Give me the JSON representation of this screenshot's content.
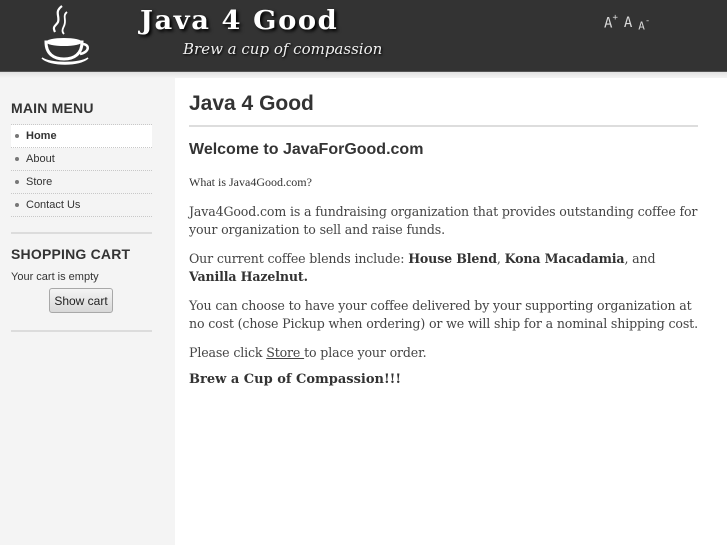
{
  "header": {
    "brand_title": "Java 4 Good",
    "tagline": "Brew a cup of compassion",
    "logo_icon": "coffee-cup-icon",
    "font_tools": {
      "increase_label": "A",
      "increase_sup": "+",
      "normal_label": "A",
      "decrease_label": "A",
      "decrease_sup": "-"
    }
  },
  "sidebar": {
    "main_menu": {
      "title": "MAIN MENU",
      "items": [
        {
          "label": "Home",
          "active": true
        },
        {
          "label": "About",
          "active": false
        },
        {
          "label": "Store",
          "active": false
        },
        {
          "label": "Contact Us",
          "active": false
        }
      ]
    },
    "shopping_cart": {
      "title": "SHOPPING CART",
      "status": "Your cart is empty",
      "button_label": "Show cart"
    }
  },
  "content": {
    "page_title": "Java 4 Good",
    "welcome": "Welcome to JavaForGood.com",
    "question": "What is Java4Good.com?",
    "intro": "Java4Good.com is a fundraising organization that provides outstanding coffee for your organization to sell and raise funds.",
    "blends": {
      "prefix": "Our current coffee blends include: ",
      "blend_1": "House Blend",
      "sep_1": ", ",
      "blend_2": "Kona Macadamia",
      "sep_2": ", and ",
      "blend_3": "Vanilla Hazelnut."
    },
    "delivery": "You can choose to have your coffee delivered by your supporting organization at no cost (chose Pickup when ordering) or we will ship for a nominal shipping cost.",
    "order": {
      "prefix": "Please click ",
      "link": "Store ",
      "suffix": "to place your order."
    },
    "slogan": "Brew a Cup of Compassion!!!"
  }
}
